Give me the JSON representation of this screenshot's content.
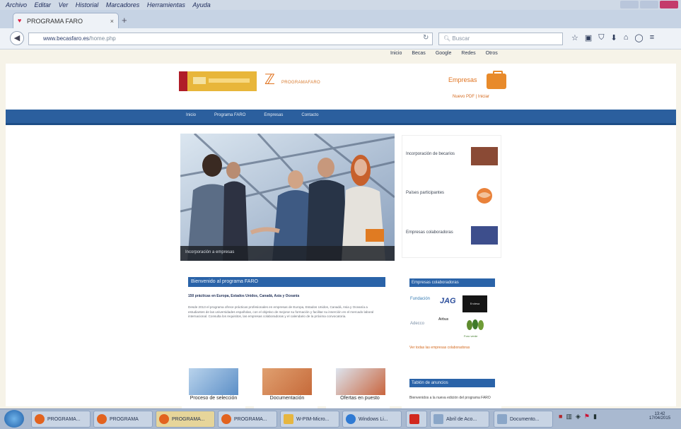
{
  "browser": {
    "menu": [
      "Archivo",
      "Editar",
      "Ver",
      "Historial",
      "Marcadores",
      "Herramientas",
      "Ayuda"
    ],
    "tab_title": "PROGRAMA FARO",
    "tab_close": "×",
    "new_tab": "+",
    "url_site": "www.becasfaro.es",
    "url_path": "/home.php",
    "search_placeholder": "Buscar",
    "bookmarks": [
      "Inicio",
      "Becas",
      "Google",
      "Redes",
      "Otros"
    ],
    "icons": [
      "star-icon",
      "clipboard-icon",
      "shield-icon",
      "download-icon",
      "home-icon",
      "chat-icon",
      "menu-icon"
    ]
  },
  "header": {
    "faro_logo_text": "PROGRAMAFARO",
    "empresas": "Empresas",
    "account_links": "Nuevo PDF  |  Iniciar"
  },
  "nav": [
    "Inicio",
    "Programa FARO",
    "Empresas",
    "Contacto"
  ],
  "hero": {
    "caption": "Incorporación a empresas"
  },
  "sidebar": {
    "items": [
      "Incorporación de becarios",
      "Países participantes",
      "Empresas colaboradoras"
    ],
    "icons": [
      "handshake-icon",
      "globe-icon",
      "people-icon"
    ]
  },
  "content": {
    "title": "Bienvenido al programa FARO",
    "subtitle": "150 prácticas en Europa, Estados Unidos, Canadá, Asia y Oceanía",
    "body": "Desde 2013 el programa ofrece prácticas profesionales en empresas de Europa, Estados Unidos, Canadá, Asia y Oceanía a estudiantes de las universidades españolas, con el objetivo de mejorar su formación y facilitar su inserción en el mercado laboral internacional. Consulta los requisitos, las empresas colaboradoras y el calendario de la próxima convocatoria."
  },
  "partners": {
    "title": "Empresas colaboradoras",
    "logos": [
      "Fundación",
      "JAG",
      "Endesa",
      "Adecco",
      "Airbus",
      "Foro verde"
    ],
    "link": "Ver todas las empresas colaboradoras"
  },
  "cards": [
    {
      "label": "Proceso de selección"
    },
    {
      "label": "Documentación"
    },
    {
      "label": "Ofertas en puesto"
    }
  ],
  "board": {
    "title": "Tablón de anuncios",
    "text": "Bienvenidos a la nueva edición del programa FARO"
  },
  "taskbar": {
    "buttons": [
      "PROGRAMA...",
      "PROGRAMA",
      "PROGRAMA...",
      "PROGRAMA...",
      "W-PIM-Micro...",
      "Windows Li...",
      "Abril de Aco...",
      "Documento..."
    ],
    "clock_time": "13:42",
    "clock_date": "17/04/2015"
  }
}
